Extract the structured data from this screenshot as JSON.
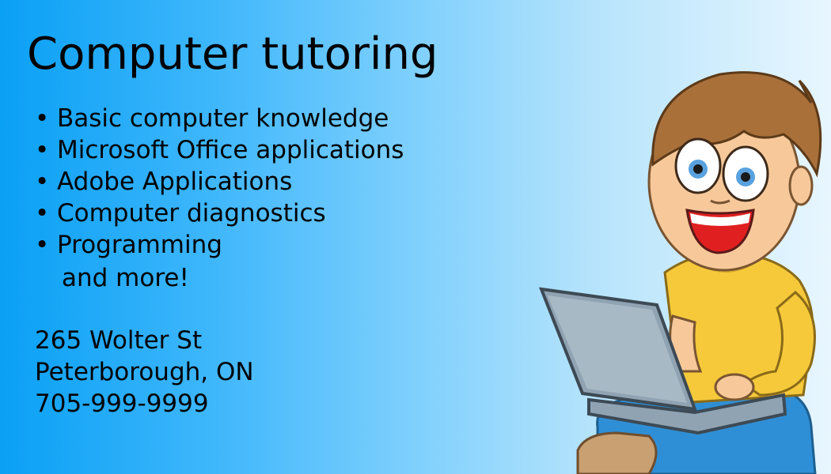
{
  "title": "Computer tutoring",
  "bullet_symbol": "•",
  "services": [
    "Basic computer knowledge",
    "Microsoft Office applications",
    "Adobe Applications",
    "Computer diagnostics",
    "Programming"
  ],
  "more_text": "and more!",
  "contact": {
    "street": "265 Wolter St",
    "city": "Peterborough, ON",
    "phone": "705-999-9999"
  },
  "colors": {
    "background_left": "#0aa0f5",
    "background_right": "#e8f6fe",
    "shirt": "#f5c93a",
    "shorts": "#2f8fd6",
    "laptop": "#8fa3b3",
    "hair": "#a9703a"
  },
  "illustration_subject": "boy-with-laptop"
}
